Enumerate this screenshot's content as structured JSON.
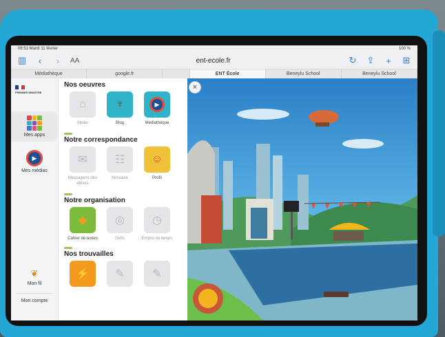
{
  "browser": {
    "status_time": "08:51  Mardi 11 février",
    "status_right": "100 %",
    "url": "ent-ecole.fr",
    "aa": "AA",
    "tabs": [
      {
        "label": "Médiathèque",
        "active": false
      },
      {
        "label": "google.fr",
        "active": false
      },
      {
        "label": "",
        "active": false
      },
      {
        "label": "ENT École",
        "active": true
      },
      {
        "label": "Beneylu School",
        "active": false
      },
      {
        "label": "Beneylu School",
        "active": false
      }
    ]
  },
  "rail": {
    "logo_lines": "PREMIER MINISTRE",
    "items": [
      {
        "label": "Mes apps",
        "icon": "apps-grid-icon",
        "active": true
      },
      {
        "label": "Mes médias",
        "icon": "media-play-icon"
      },
      {
        "label": "Mon fil",
        "icon": "bird-icon"
      },
      {
        "label": "Mon compte",
        "icon": ""
      }
    ]
  },
  "panel": {
    "sections": [
      {
        "title": "Nos oeuvres",
        "apps": [
          {
            "label": "Atelier",
            "icon": "easel-icon",
            "color": "#e3e5e8",
            "muted": true
          },
          {
            "label": "Blog",
            "icon": "tree-icon",
            "color": "#2fb3c9",
            "muted": false
          },
          {
            "label": "Médiathèque",
            "icon": "play-disc-icon",
            "color": "#2fb3c9",
            "muted": false
          }
        ]
      },
      {
        "title": "Notre correspondance",
        "apps": [
          {
            "label": "Messagerie des élèves",
            "icon": "mailbox-icon",
            "color": "#e3e5e8",
            "muted": true
          },
          {
            "label": "Annuaire",
            "icon": "directory-icon",
            "color": "#e3e5e8",
            "muted": true
          },
          {
            "label": "Profil",
            "icon": "profile-badge-icon",
            "color": "#f0c23a",
            "muted": false
          }
        ]
      },
      {
        "title": "Notre organisation",
        "apps": [
          {
            "label": "Cahier de textes",
            "icon": "notebook-icon",
            "color": "#7dbb3c",
            "muted": false
          },
          {
            "label": "Défis",
            "icon": "target-icon",
            "color": "#e3e5e8",
            "muted": true
          },
          {
            "label": "Emploi du temps",
            "icon": "clock-icon",
            "color": "#e3e5e8",
            "muted": true
          }
        ]
      },
      {
        "title": "Nos trouvailles",
        "apps": [
          {
            "label": "",
            "icon": "lightning-icon",
            "color": "#f39a1f",
            "muted": false
          },
          {
            "label": "",
            "icon": "tool-icon",
            "color": "#e3e5e8",
            "muted": true
          },
          {
            "label": "",
            "icon": "tool-icon",
            "color": "#e3e5e8",
            "muted": true
          }
        ]
      }
    ]
  },
  "close_glyph": "×"
}
